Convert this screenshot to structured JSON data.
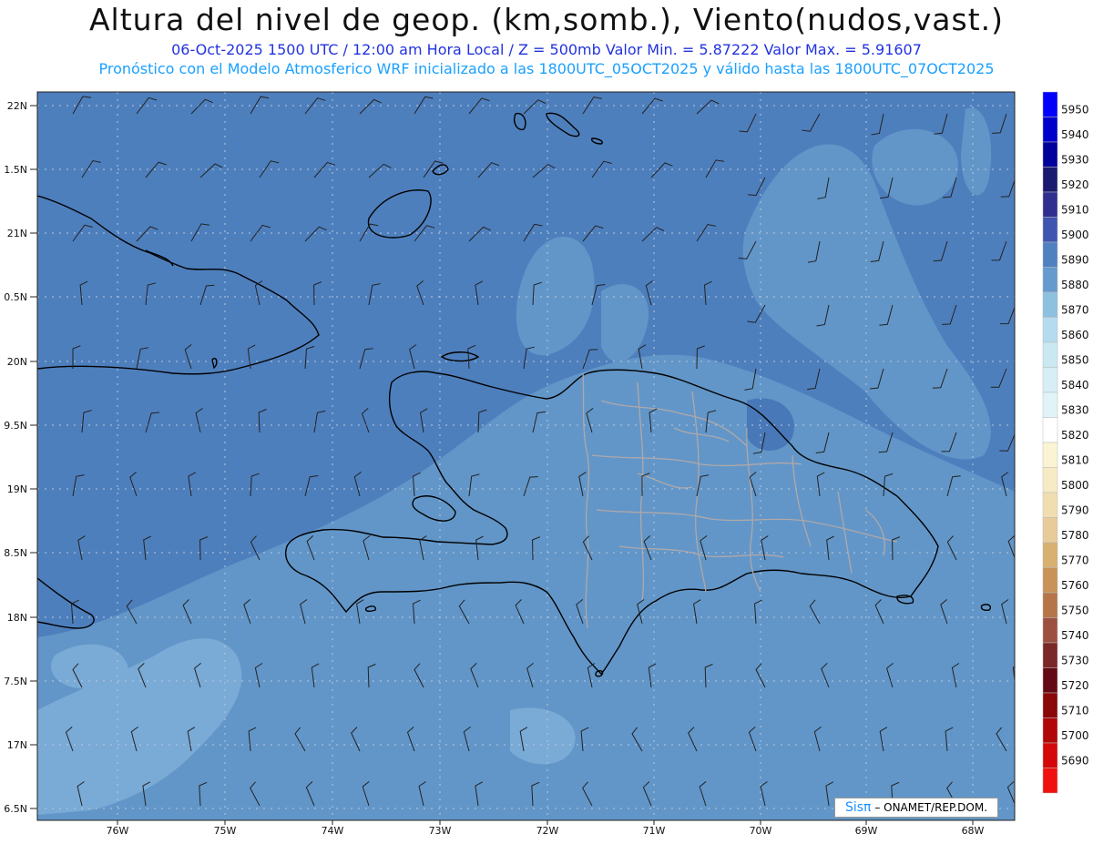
{
  "header": {
    "title": "Altura del nivel de geop. (km,somb.), Viento(nudos,vast.)",
    "line1": "06-Oct-2025  1500 UTC / 12:00 am Hora Local / Z = 500mb    Valor Min. = 5.87222  Valor Max. = 5.91607",
    "line2": "Pronóstico con el Modelo Atmosferico WRF inicializado a las 1800UTC_05OCT2025 y válido hasta las  1800UTC_07OCT2025"
  },
  "axes": {
    "lat_labels": [
      "22N",
      "1.5N",
      "21N",
      "0.5N",
      "20N",
      "9.5N",
      "19N",
      "8.5N",
      "18N",
      "7.5N",
      "17N",
      "6.5N"
    ],
    "lon_labels": [
      "76W",
      "75W",
      "74W",
      "73W",
      "72W",
      "71W",
      "70W",
      "69W",
      "68W"
    ]
  },
  "colorbar": {
    "labels": [
      "5950",
      "5940",
      "5930",
      "5920",
      "5910",
      "5900",
      "5890",
      "5880",
      "5870",
      "5860",
      "5850",
      "5840",
      "5830",
      "5820",
      "5810",
      "5800",
      "5790",
      "5780",
      "5770",
      "5760",
      "5750",
      "5740",
      "5730",
      "5720",
      "5710",
      "5700",
      "5690"
    ],
    "colors": [
      "#0000ff",
      "#0000cc",
      "#00009a",
      "#1a1a70",
      "#2f2f90",
      "#3f55b0",
      "#4f80c0",
      "#659ace",
      "#8ec0e0",
      "#b4dcee",
      "#c9e8f2",
      "#d8eef5",
      "#e0f4f8",
      "#ffffff",
      "#fbf4d4",
      "#f6ebc4",
      "#f0deb0",
      "#e7cc9a",
      "#d8b070",
      "#c89258",
      "#b57548",
      "#9c5040",
      "#7a2828",
      "#650a14",
      "#8a0808",
      "#b00808",
      "#d40808",
      "#f01010"
    ]
  },
  "credit": {
    "brand": "Sis",
    "pi": "π",
    "text": "– ONAMET/REP.DOM."
  },
  "colors": {
    "field_dark": "#4e7fbd",
    "field_mid": "#6296c8",
    "field_light": "#7aaad6",
    "coast": "#000000",
    "provinces": "#b0a8a8",
    "grid": "#b8c8e0"
  }
}
